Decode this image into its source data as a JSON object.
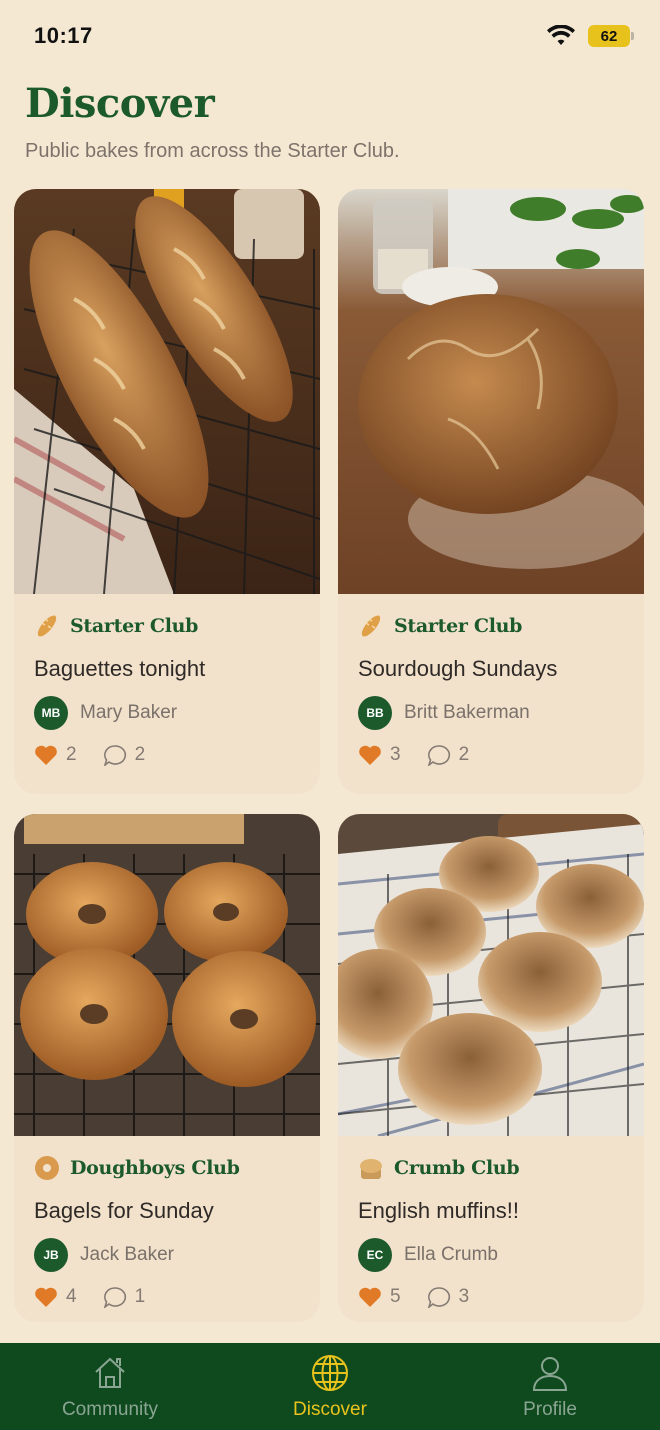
{
  "status_bar": {
    "time": "10:17",
    "battery": "62"
  },
  "header": {
    "title": "Discover",
    "subtitle": "Public bakes from across the Starter Club."
  },
  "cards": [
    {
      "image": "baguettes-photo",
      "club": {
        "icon": "baguette-icon",
        "name": "Starter Club"
      },
      "title": "Baguettes tonight",
      "author": {
        "initials": "MB",
        "name": "Mary Baker"
      },
      "likes": "2",
      "comments": "2"
    },
    {
      "image": "sourdough-boule-photo",
      "club": {
        "icon": "baguette-icon",
        "name": "Starter Club"
      },
      "title": "Sourdough Sundays",
      "author": {
        "initials": "BB",
        "name": "Britt Bakerman"
      },
      "likes": "3",
      "comments": "2"
    },
    {
      "image": "bagels-photo",
      "club": {
        "icon": "bagel-icon",
        "name": "Doughboys Club"
      },
      "title": "Bagels for Sunday",
      "author": {
        "initials": "JB",
        "name": "Jack Baker"
      },
      "likes": "4",
      "comments": "1"
    },
    {
      "image": "english-muffins-photo",
      "club": {
        "icon": "muffin-icon",
        "name": "Crumb Club"
      },
      "title": "English muffins!!",
      "author": {
        "initials": "EC",
        "name": "Ella Crumb"
      },
      "likes": "5",
      "comments": "3"
    }
  ],
  "nav": {
    "items": [
      {
        "label": "Community",
        "icon": "house-icon",
        "active": false
      },
      {
        "label": "Discover",
        "icon": "globe-icon",
        "active": true
      },
      {
        "label": "Profile",
        "icon": "person-icon",
        "active": false
      }
    ]
  },
  "colors": {
    "background": "#f5e8d3",
    "brand_green": "#1c5a2c",
    "nav_background": "#0f4a1f",
    "active_accent": "#e8c21c",
    "heart": "#e07a26"
  }
}
